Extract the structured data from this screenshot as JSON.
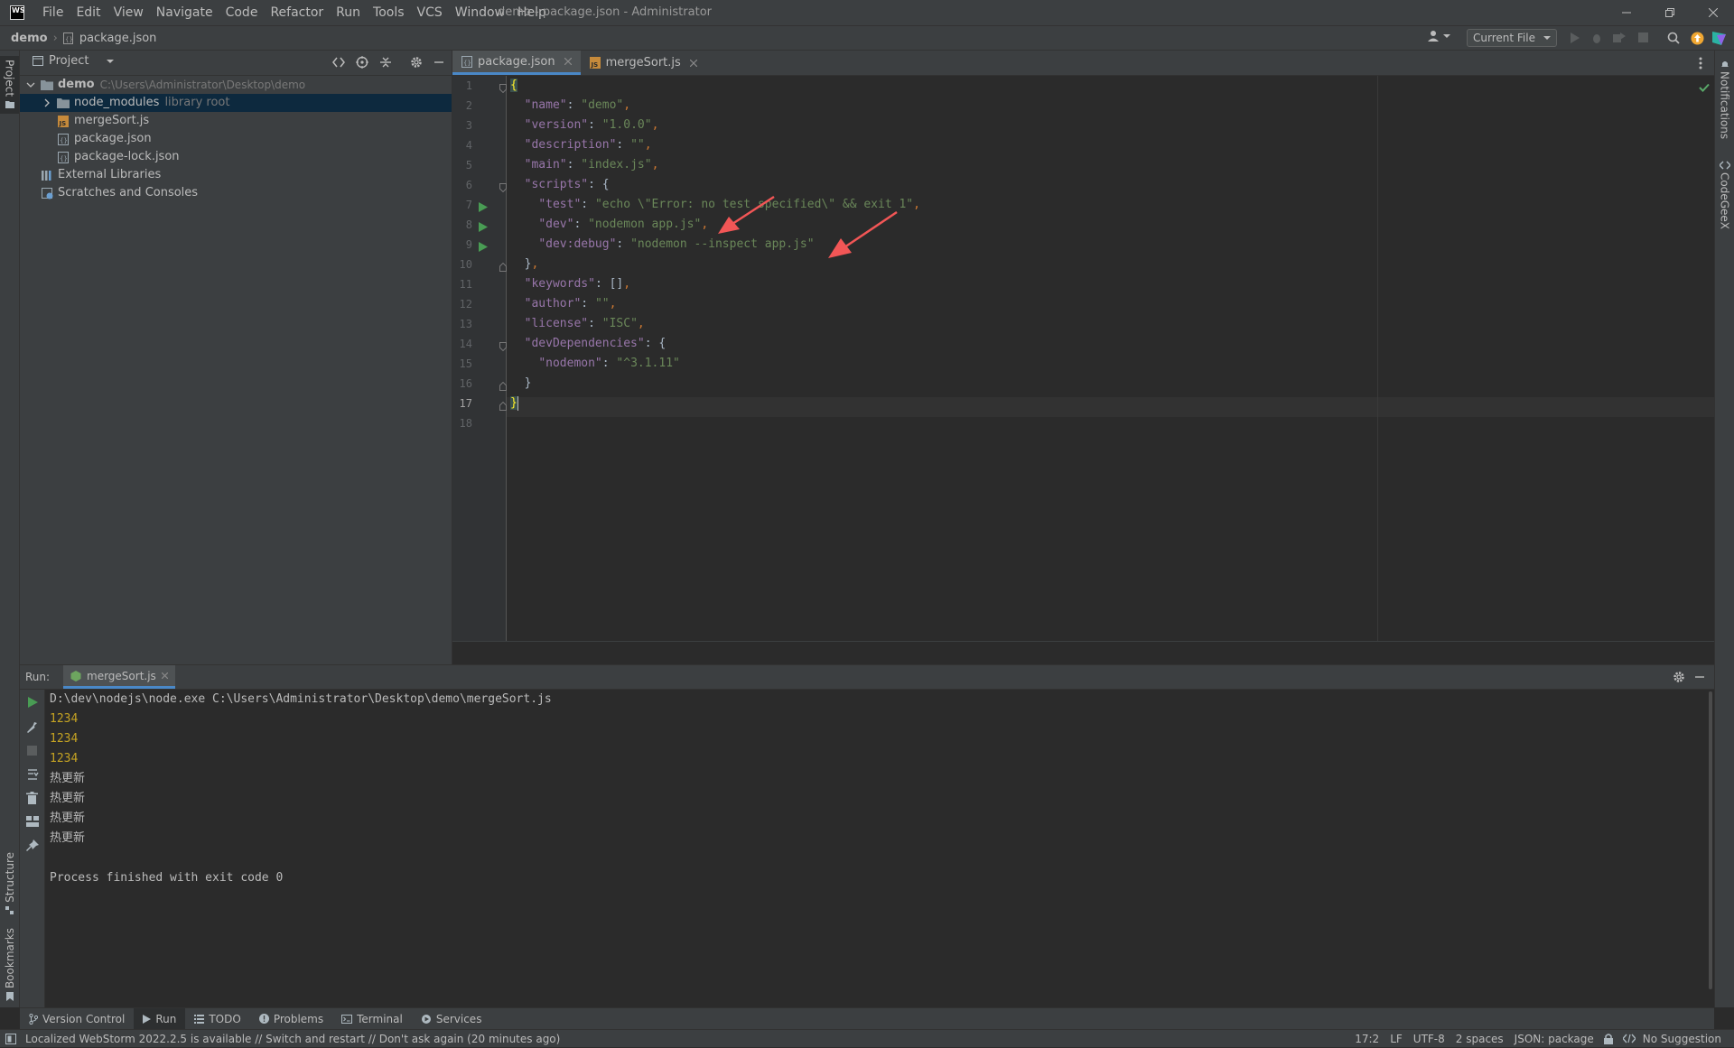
{
  "window": {
    "logo": "WS",
    "title": "demo - package.json - Administrator"
  },
  "menu": [
    {
      "label": "File"
    },
    {
      "label": "Edit"
    },
    {
      "label": "View"
    },
    {
      "label": "Navigate"
    },
    {
      "label": "Code"
    },
    {
      "label": "Refactor"
    },
    {
      "label": "Run"
    },
    {
      "label": "Tools"
    },
    {
      "label": "VCS"
    },
    {
      "label": "Window"
    },
    {
      "label": "Help"
    }
  ],
  "navbar": {
    "project": "demo",
    "file": "package.json",
    "run_config": "Current File"
  },
  "left_stripe": {
    "project": "Project",
    "structure": "Structure",
    "bookmarks": "Bookmarks"
  },
  "right_stripe": {
    "notifications": "Notifications",
    "codegeex": "CodeGeeX"
  },
  "project_panel": {
    "title": "Project",
    "tree": [
      {
        "label": "demo",
        "hint": "C:\\Users\\Administrator\\Desktop\\demo"
      },
      {
        "label": "node_modules",
        "hint": "library root"
      },
      {
        "label": "mergeSort.js",
        "hint": ""
      },
      {
        "label": "package.json",
        "hint": ""
      },
      {
        "label": "package-lock.json",
        "hint": ""
      },
      {
        "label": "External Libraries",
        "hint": ""
      },
      {
        "label": "Scratches and Consoles",
        "hint": ""
      }
    ]
  },
  "editor": {
    "tabs": [
      {
        "label": "package.json",
        "active": true
      },
      {
        "label": "mergeSort.js",
        "active": false
      }
    ],
    "current_line": 17,
    "lines": [
      "{",
      "  \"name\": \"demo\",",
      "  \"version\": \"1.0.0\",",
      "  \"description\": \"\",",
      "  \"main\": \"index.js\",",
      "  \"scripts\": {",
      "    \"test\": \"echo \\\"Error: no test specified\\\" && exit 1\",",
      "    \"dev\": \"nodemon app.js\",",
      "    \"dev:debug\": \"nodemon --inspect app.js\"",
      "  },",
      "  \"keywords\": [],",
      "  \"author\": \"\",",
      "  \"license\": \"ISC\",",
      "  \"devDependencies\": {",
      "    \"nodemon\": \"^3.1.11\"",
      "  }",
      "}",
      ""
    ],
    "line_numbers": [
      "1",
      "2",
      "3",
      "4",
      "5",
      "6",
      "7",
      "8",
      "9",
      "10",
      "11",
      "12",
      "13",
      "14",
      "15",
      "16",
      "17",
      "18"
    ]
  },
  "run_panel": {
    "label": "Run:",
    "tab": "mergeSort.js",
    "output": [
      {
        "text": "D:\\dev\\nodejs\\node.exe C:\\Users\\Administrator\\Desktop\\demo\\mergeSort.js",
        "color": "#bbbbbb"
      },
      {
        "text": "1234",
        "color": "#c5a323"
      },
      {
        "text": "1234",
        "color": "#c5a323"
      },
      {
        "text": "1234",
        "color": "#c5a323"
      },
      {
        "text": "热更新",
        "color": "#bbbbbb"
      },
      {
        "text": "热更新",
        "color": "#bbbbbb"
      },
      {
        "text": "热更新",
        "color": "#bbbbbb"
      },
      {
        "text": "热更新",
        "color": "#bbbbbb"
      },
      {
        "text": "",
        "color": "#bbbbbb"
      },
      {
        "text": "Process finished with exit code 0",
        "color": "#bbbbbb"
      }
    ]
  },
  "tool_tabs": [
    {
      "label": "Version Control",
      "icon": "branch-icon"
    },
    {
      "label": "Run",
      "icon": "play-icon"
    },
    {
      "label": "TODO",
      "icon": "list-icon"
    },
    {
      "label": "Problems",
      "icon": "info-icon"
    },
    {
      "label": "Terminal",
      "icon": "terminal-icon"
    },
    {
      "label": "Services",
      "icon": "services-icon"
    }
  ],
  "status": {
    "message": "Localized WebStorm 2022.2.5 is available // Switch and restart // Don't ask again (20 minutes ago)",
    "position": "17:2",
    "line_sep": "LF",
    "encoding": "UTF-8",
    "indent": "2 spaces",
    "schema": "JSON: package",
    "suggestion": "No Suggestion"
  },
  "colors": {
    "accent": "#4a88c7",
    "run_green": "#499c54",
    "annotation_red": "#f25656",
    "check_green": "#59a869"
  }
}
